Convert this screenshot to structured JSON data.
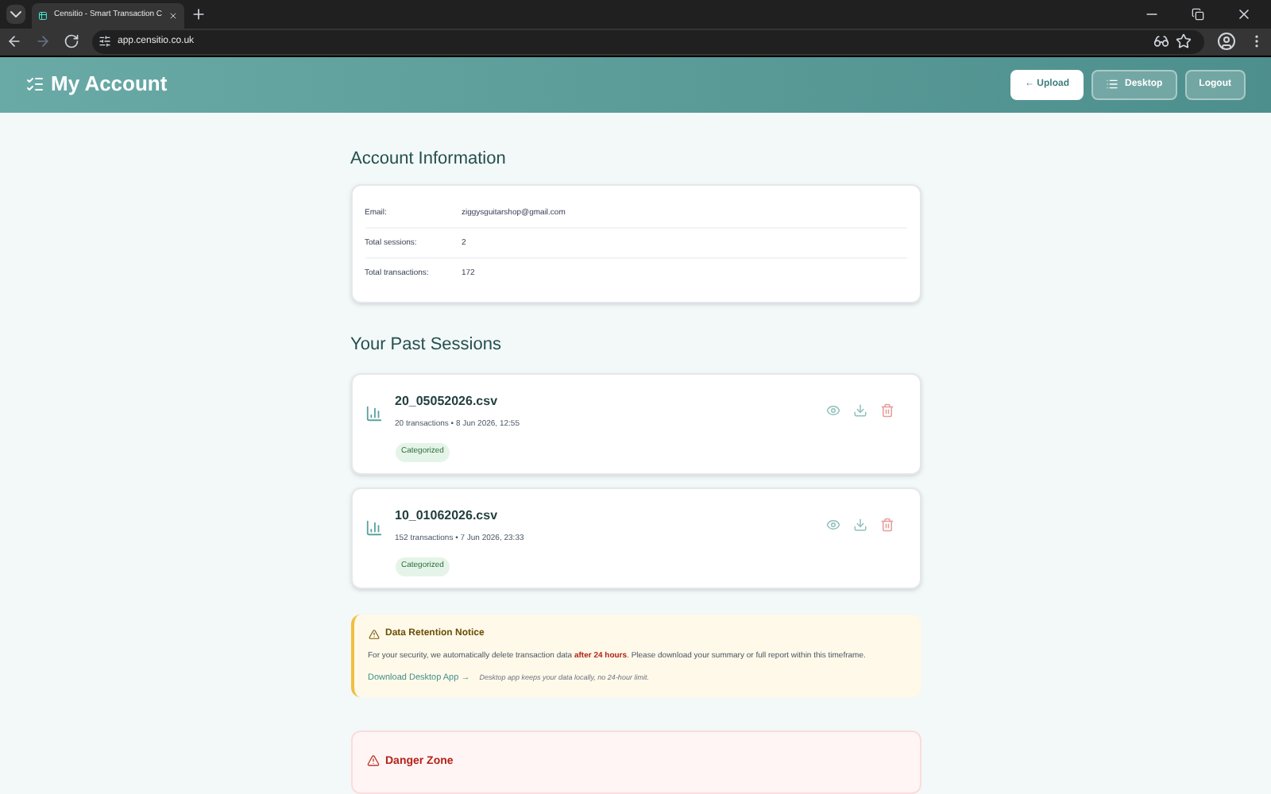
{
  "browser": {
    "tab_title": "Censitio - Smart Transaction C",
    "url": "app.censitio.co.uk"
  },
  "header": {
    "title": "My Account",
    "buttons": [
      {
        "label": "← Upload",
        "kind": "primary"
      },
      {
        "label": "Desktop",
        "kind": "icon"
      },
      {
        "label": "Logout",
        "kind": "plain"
      }
    ]
  },
  "account": {
    "heading": "Account Information",
    "rows": [
      {
        "label": "Email:",
        "value": "ziggysguitarshop@gmail.com"
      },
      {
        "label": "Total sessions:",
        "value": "2"
      },
      {
        "label": "Total transactions:",
        "value": "172"
      }
    ]
  },
  "sessions": {
    "heading": "Your Past Sessions",
    "items": [
      {
        "file": "20_05052026.csv",
        "meta": "20 transactions • 8 Jun 2026, 12:55",
        "status": "Categorized"
      },
      {
        "file": "10_01062026.csv",
        "meta": "152 transactions • 7 Jun 2026, 23:33",
        "status": "Categorized"
      }
    ]
  },
  "notice": {
    "title": "Data Retention Notice",
    "text": "For your security, we automatically delete transaction data **after 24 hours**. Please download your summary or full report within this timeframe.",
    "link": "Download Desktop App →",
    "note": "Desktop app keeps your data locally, no 24-hour limit."
  },
  "danger": {
    "title": "Danger Zone"
  }
}
